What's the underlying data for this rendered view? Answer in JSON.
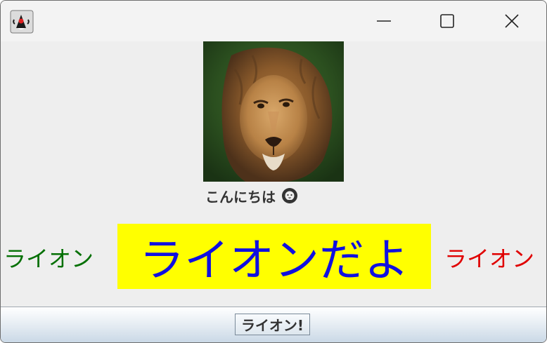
{
  "window": {
    "app_icon": "java-duke-icon",
    "controls": {
      "minimize": "minimize-icon",
      "maximize": "maximize-icon",
      "close": "close-icon"
    }
  },
  "photo": {
    "subject": "lion-photo"
  },
  "greeting": {
    "text": "こんにちは",
    "icon": "lion-face-icon"
  },
  "labels": {
    "left": {
      "text": "ライオン",
      "color": "#047004"
    },
    "center": {
      "text": "ライオンだよ",
      "color": "#1010e0",
      "background": "#ffff00"
    },
    "right": {
      "text": "ライオン",
      "color": "#e00000"
    }
  },
  "bottom": {
    "button_label": "ライオン!"
  }
}
